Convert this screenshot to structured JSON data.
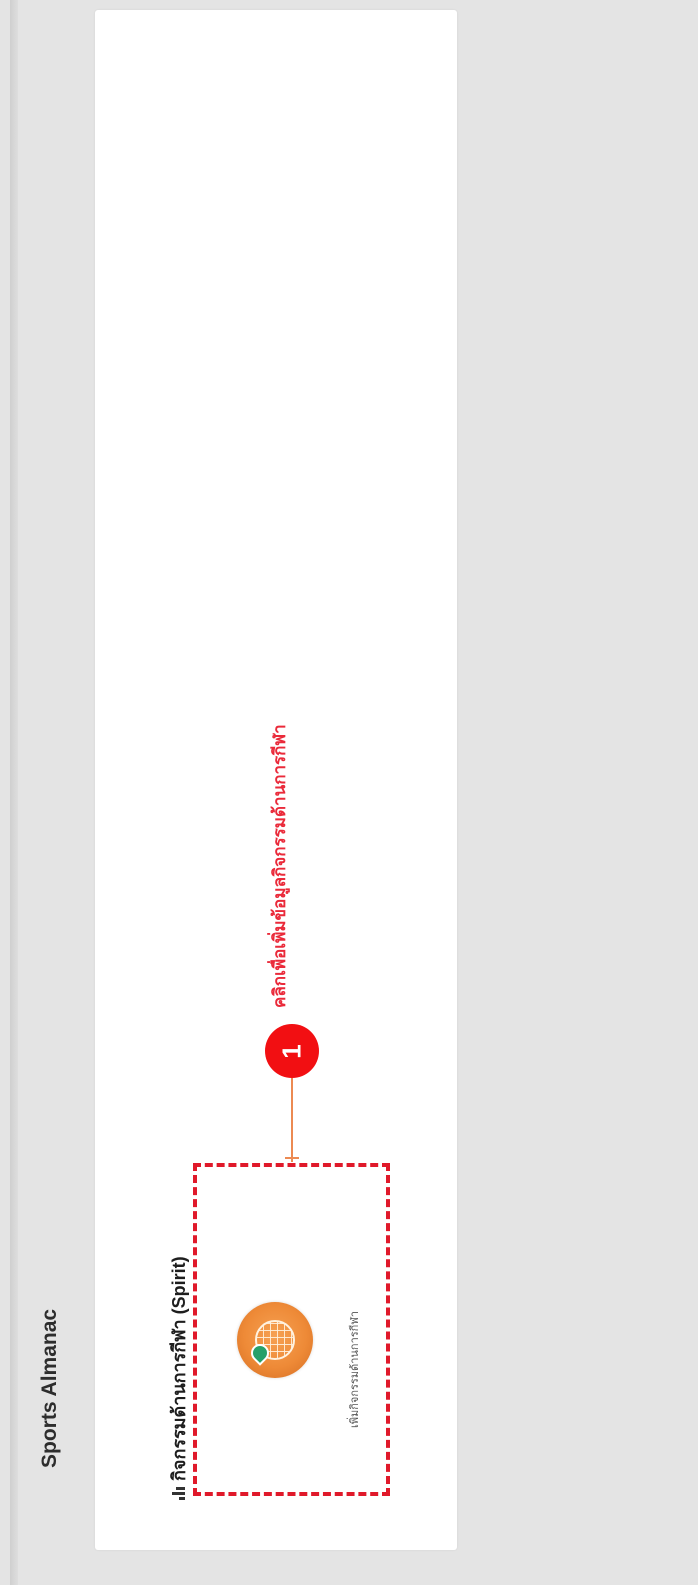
{
  "app": {
    "title": "Sports Almanac"
  },
  "section": {
    "title": "กิจกรรมด้านการกีฬา (Spirit)"
  },
  "item": {
    "caption": "เพิ่มกิจกรรมด้านการกีฬา",
    "icon": "globe-pin-icon"
  },
  "annotation": {
    "number": "1",
    "text": "คลิกเพื่อเพิ่มข้อมูลกิจกรรมด้านการกีฬา"
  },
  "colors": {
    "annotation": "#ea2a3a",
    "badge": "#f20f12",
    "dashed_border": "#e0192a",
    "icon_bg": "#ee8a37"
  }
}
